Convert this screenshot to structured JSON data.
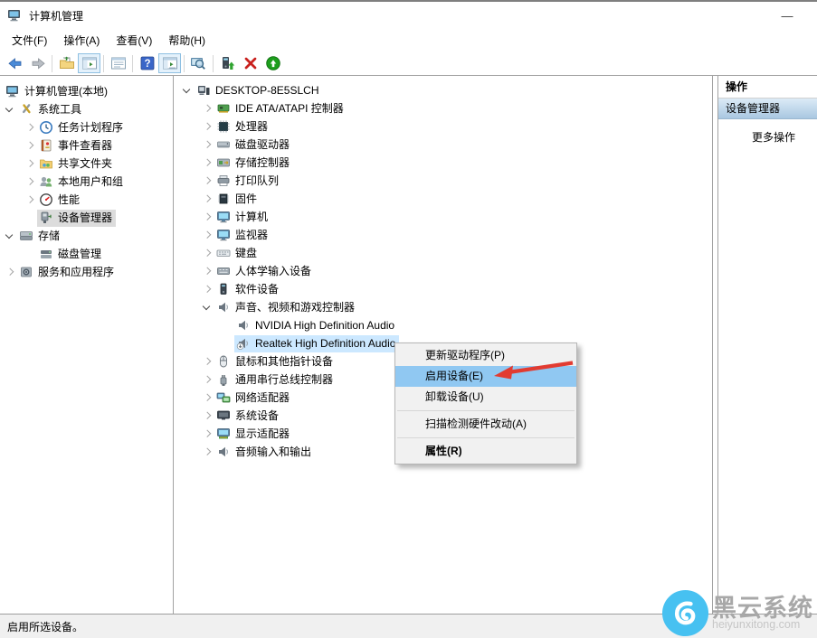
{
  "window": {
    "title": "计算机管理",
    "minimize_glyph": "—"
  },
  "menu_bar": {
    "items": [
      {
        "name": "file",
        "label": "文件(F)"
      },
      {
        "name": "action",
        "label": "操作(A)"
      },
      {
        "name": "view",
        "label": "查看(V)"
      },
      {
        "name": "help",
        "label": "帮助(H)"
      }
    ]
  },
  "toolbar": {
    "buttons": [
      {
        "name": "back",
        "icon": "back-arrow"
      },
      {
        "name": "forward",
        "icon": "forward-arrow",
        "sep": true
      },
      {
        "name": "export-folder",
        "icon": "export-folder"
      },
      {
        "name": "console-tree-toggle",
        "icon": "console-window",
        "highlighted": true,
        "sep": true
      },
      {
        "name": "properties",
        "icon": "list-window",
        "sep": true
      },
      {
        "name": "help",
        "icon": "help-question"
      },
      {
        "name": "show-hide-panel",
        "icon": "show-window",
        "highlighted": true,
        "sep": true
      },
      {
        "name": "export-list",
        "icon": "magnifier-monitor",
        "sep": true
      },
      {
        "name": "enable-device",
        "icon": "device-green-arrow"
      },
      {
        "name": "uninstall-device",
        "icon": "red-x"
      },
      {
        "name": "update-driver",
        "icon": "green-up-circle"
      }
    ]
  },
  "left_tree": {
    "items": [
      {
        "label": "计算机管理(本地)",
        "icon": "mgmt",
        "level": 0,
        "exp": "h"
      },
      {
        "label": "系统工具",
        "icon": "tools",
        "level": 0,
        "exp": "e"
      },
      {
        "label": "任务计划程序",
        "icon": "scheduler",
        "level": 1,
        "exp": "c"
      },
      {
        "label": "事件查看器",
        "icon": "events",
        "level": 1,
        "exp": "c"
      },
      {
        "label": "共享文件夹",
        "icon": "sharedfolder",
        "level": 1,
        "exp": "c"
      },
      {
        "label": "本地用户和组",
        "icon": "users",
        "level": 1,
        "exp": "c"
      },
      {
        "label": "性能",
        "icon": "performance",
        "level": 1,
        "exp": "c"
      },
      {
        "label": "设备管理器",
        "icon": "devicemgr",
        "level": 1,
        "exp": "s",
        "sel": "gray"
      },
      {
        "label": "存储",
        "icon": "storage",
        "level": 0,
        "exp": "e"
      },
      {
        "label": "磁盘管理",
        "icon": "diskmgmt",
        "level": 1,
        "exp": "s"
      },
      {
        "label": "服务和应用程序",
        "icon": "services",
        "level": 0,
        "exp": "c"
      }
    ]
  },
  "device_tree": {
    "items": [
      {
        "label": "DESKTOP-8E5SLCH",
        "icon": "pc",
        "level": 0,
        "exp": "e"
      },
      {
        "label": "IDE ATA/ATAPI 控制器",
        "icon": "idecard",
        "level": 1,
        "exp": "c"
      },
      {
        "label": "处理器",
        "icon": "chip",
        "level": 1,
        "exp": "c"
      },
      {
        "label": "磁盘驱动器",
        "icon": "hdd",
        "level": 1,
        "exp": "c"
      },
      {
        "label": "存储控制器",
        "icon": "storagectrl",
        "level": 1,
        "exp": "c"
      },
      {
        "label": "打印队列",
        "icon": "printer",
        "level": 1,
        "exp": "c"
      },
      {
        "label": "固件",
        "icon": "firmware",
        "level": 1,
        "exp": "c"
      },
      {
        "label": "计算机",
        "icon": "monitor",
        "level": 1,
        "exp": "c"
      },
      {
        "label": "监视器",
        "icon": "monitor",
        "level": 1,
        "exp": "c"
      },
      {
        "label": "键盘",
        "icon": "keyboard",
        "level": 1,
        "exp": "c"
      },
      {
        "label": "人体学输入设备",
        "icon": "hid",
        "level": 1,
        "exp": "c"
      },
      {
        "label": "软件设备",
        "icon": "software",
        "level": 1,
        "exp": "c"
      },
      {
        "label": "声音、视频和游戏控制器",
        "icon": "speaker",
        "level": 1,
        "exp": "e"
      },
      {
        "label": "NVIDIA High Definition Audio",
        "icon": "speaker",
        "level": 2,
        "exp": "s"
      },
      {
        "label": "Realtek High Definition Audio",
        "icon": "speakerdisabled",
        "level": 2,
        "exp": "s",
        "sel": "blue"
      },
      {
        "label": "鼠标和其他指针设备",
        "icon": "mouse",
        "level": 1,
        "exp": "c"
      },
      {
        "label": "通用串行总线控制器",
        "icon": "usb",
        "level": 1,
        "exp": "c"
      },
      {
        "label": "网络适配器",
        "icon": "network",
        "level": 1,
        "exp": "c"
      },
      {
        "label": "系统设备",
        "icon": "sysdev",
        "level": 1,
        "exp": "c"
      },
      {
        "label": "显示适配器",
        "icon": "display",
        "level": 1,
        "exp": "c"
      },
      {
        "label": "音频输入和输出",
        "icon": "audioio",
        "level": 1,
        "exp": "c"
      }
    ]
  },
  "context_menu": {
    "items": [
      {
        "label": "更新驱动程序(P)"
      },
      {
        "label": "启用设备(E)",
        "highlighted": true
      },
      {
        "label": "卸载设备(U)"
      },
      {
        "type": "separator"
      },
      {
        "label": "扫描检测硬件改动(A)"
      },
      {
        "type": "separator"
      },
      {
        "label": "属性(R)",
        "bold": true
      }
    ]
  },
  "actions_panel": {
    "header": "操作",
    "section_title": "设备管理器",
    "more_actions_label": "更多操作"
  },
  "status_bar": {
    "text": "启用所选设备。"
  },
  "watermark": {
    "name": "黑云系统",
    "domain": "heiyunxitong.com"
  },
  "colors": {
    "selection_blue": "#cce8ff",
    "selection_gray": "#dcdcdc",
    "menu_highlight": "#90c8f2",
    "annotation_red": "#e23b31",
    "watermark_blue": "#47c1f1",
    "actions_bar_top": "#dcebf7",
    "actions_bar_bottom": "#a9c7e1"
  }
}
